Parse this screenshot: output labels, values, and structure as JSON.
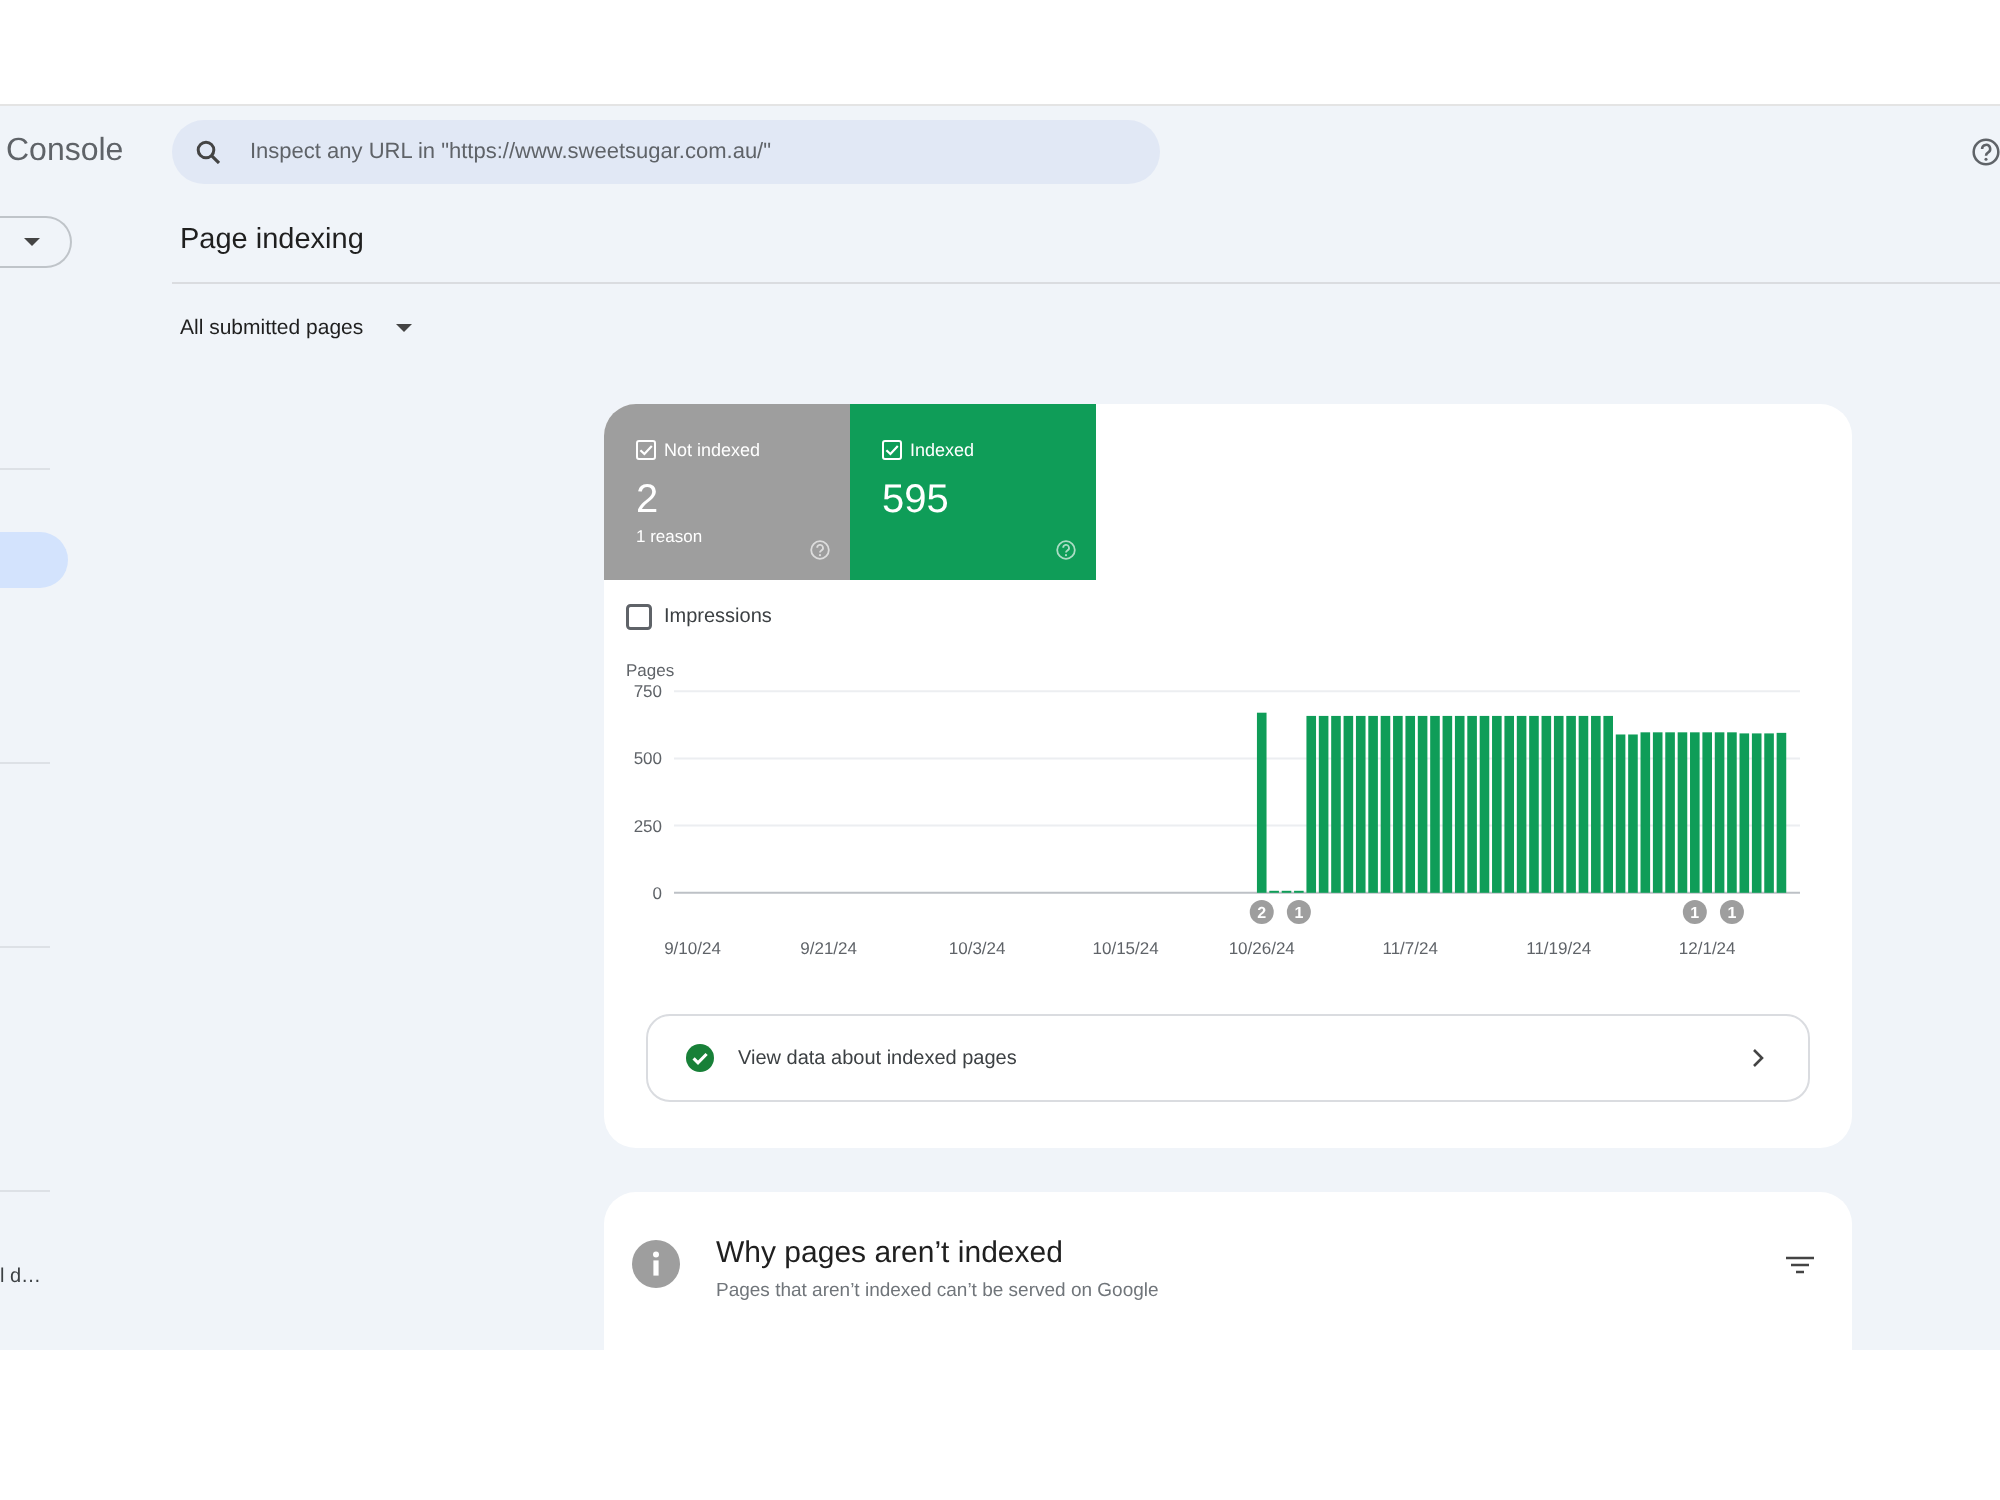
{
  "topbar": {
    "product_name": "Console",
    "search": {
      "placeholder": "Inspect any URL in \"https://www.sweetsugar.com.au/\""
    }
  },
  "sidebar": {
    "items": [
      {
        "selected": true
      },
      {
        "label": "l d…",
        "selected": false
      }
    ]
  },
  "page": {
    "title": "Page indexing",
    "filter": {
      "label": "All submitted pages"
    }
  },
  "summary": {
    "tiles": [
      {
        "label": "Not indexed",
        "count": "2",
        "detail": "1 reason",
        "checked": true,
        "color": "#9e9e9e"
      },
      {
        "label": "Indexed",
        "count": "595",
        "checked": true,
        "color": "#0f9d58"
      }
    ],
    "impressions": {
      "label": "Impressions",
      "checked": false
    },
    "chart_data": {
      "type": "bar",
      "ylabel": "Pages",
      "categories": [
        "9/10/24",
        null,
        null,
        null,
        null,
        null,
        null,
        null,
        null,
        null,
        null,
        "9/21/24",
        null,
        null,
        null,
        null,
        null,
        null,
        null,
        null,
        null,
        null,
        null,
        "10/3/24",
        null,
        null,
        null,
        null,
        null,
        null,
        null,
        null,
        null,
        null,
        null,
        "10/15/24",
        null,
        null,
        null,
        null,
        null,
        null,
        null,
        null,
        null,
        null,
        "10/26/24",
        null,
        null,
        null,
        null,
        null,
        null,
        null,
        null,
        null,
        null,
        null,
        "11/7/24",
        null,
        null,
        null,
        null,
        null,
        null,
        null,
        null,
        null,
        null,
        null,
        "11/19/24",
        null,
        null,
        null,
        null,
        null,
        null,
        null,
        null,
        null,
        null,
        null,
        "12/1/24",
        null,
        null,
        null,
        null,
        null,
        null
      ],
      "series": [
        {
          "color": "#0f9d58",
          "values": [
            null,
            null,
            null,
            null,
            null,
            null,
            null,
            null,
            null,
            null,
            null,
            null,
            null,
            null,
            null,
            null,
            null,
            null,
            null,
            null,
            null,
            null,
            null,
            null,
            null,
            null,
            null,
            null,
            null,
            null,
            null,
            null,
            null,
            null,
            null,
            null,
            null,
            null,
            null,
            null,
            null,
            null,
            null,
            null,
            null,
            null,
            670,
            0,
            0,
            0,
            658,
            658,
            658,
            658,
            658,
            658,
            658,
            658,
            658,
            658,
            658,
            658,
            658,
            658,
            658,
            658,
            658,
            658,
            658,
            658,
            658,
            658,
            658,
            658,
            658,
            589,
            589,
            597,
            597,
            597,
            597,
            597,
            597,
            597,
            597,
            593,
            593,
            593,
            595
          ]
        }
      ],
      "ylim": [
        0,
        750
      ],
      "yticks": [
        0,
        250,
        500,
        750
      ],
      "annotations": [
        "2",
        "1",
        "1",
        "1"
      ]
    },
    "link": {
      "label": "View data about indexed pages"
    }
  },
  "reasons_card": {
    "title": "Why pages aren’t indexed",
    "subtitle": "Pages that aren’t indexed can’t be served on Google"
  }
}
